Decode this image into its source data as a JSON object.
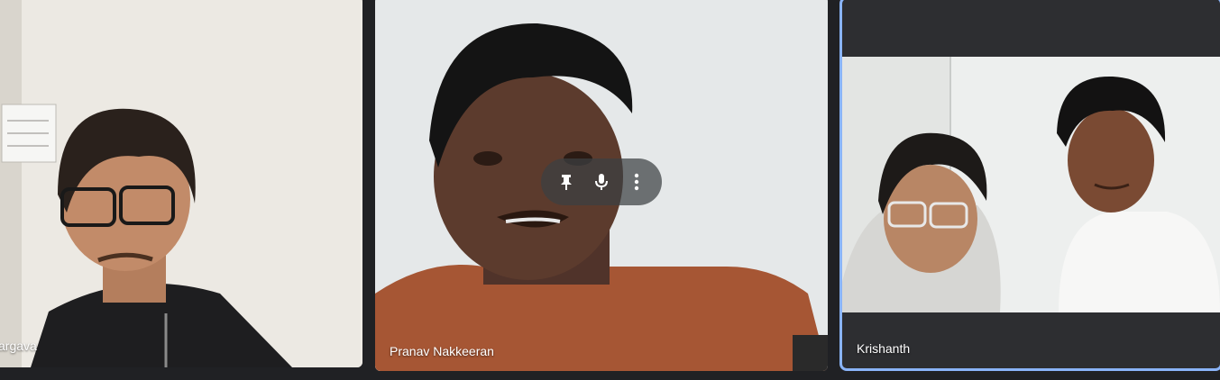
{
  "participants": [
    {
      "name": "argava"
    },
    {
      "name": "Pranav Nakkeeran"
    },
    {
      "name": "Krishanth"
    }
  ],
  "tile_controls": {
    "icons": [
      "pin-icon",
      "microphone-icon",
      "more-options-icon"
    ]
  },
  "colors": {
    "background": "#202124",
    "active_speaker_border": "#8ab4f8",
    "label_text": "#ffffff"
  }
}
